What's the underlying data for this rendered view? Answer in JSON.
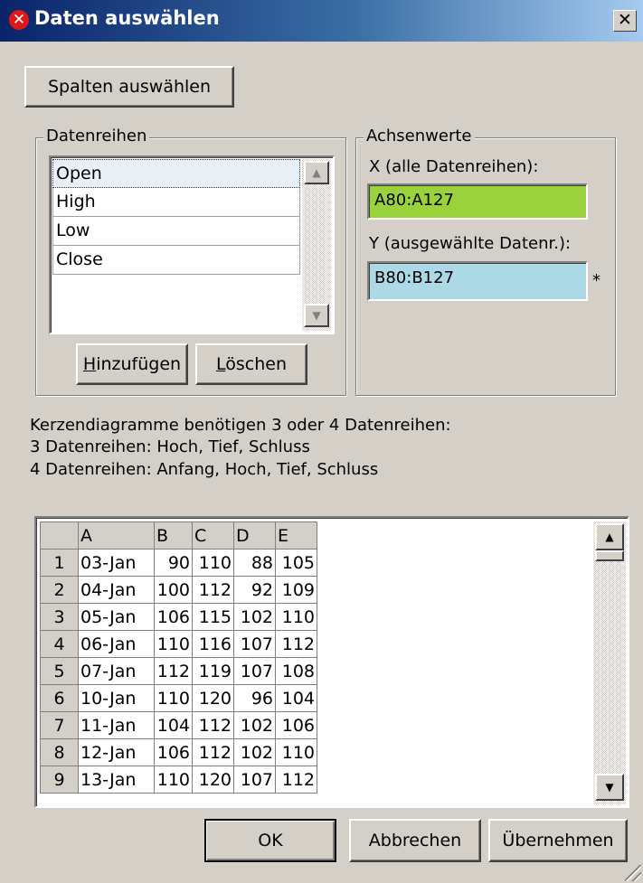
{
  "window": {
    "title": "Daten auswählen",
    "close_glyph": "✕"
  },
  "toolbar": {
    "select_columns_label": "Spalten auswählen"
  },
  "series_group": {
    "legend": "Datenreihen",
    "items": [
      "Open",
      "High",
      "Low",
      "Close"
    ],
    "selected_index": 0,
    "add_label_prefix": "H",
    "add_label_rest": "inzufügen",
    "delete_label_prefix": "L",
    "delete_label_rest": "öschen"
  },
  "axis_group": {
    "legend": "Achsenwerte",
    "x_label": "X (alle Datenreihen):",
    "x_value": "A80:A127",
    "x_color": "#9ad23c",
    "y_label": "Y (ausgewählte Datenr.):",
    "y_value": "B80:B127",
    "y_color": "#add8e6",
    "y_marker": "*"
  },
  "info": {
    "line1": "Kerzendiagramme benötigen 3 oder 4 Datenreihen:",
    "line2": "3 Datenreihen: Hoch, Tief, Schluss",
    "line3": "4 Datenreihen: Anfang, Hoch, Tief, Schluss"
  },
  "grid": {
    "columns": [
      "A",
      "B",
      "C",
      "D",
      "E"
    ],
    "rows": [
      [
        "1",
        "03-Jan",
        "90",
        "110",
        "88",
        "105"
      ],
      [
        "2",
        "04-Jan",
        "100",
        "112",
        "92",
        "109"
      ],
      [
        "3",
        "05-Jan",
        "106",
        "115",
        "102",
        "110"
      ],
      [
        "4",
        "06-Jan",
        "110",
        "116",
        "107",
        "112"
      ],
      [
        "5",
        "07-Jan",
        "112",
        "119",
        "107",
        "108"
      ],
      [
        "6",
        "10-Jan",
        "110",
        "120",
        "96",
        "104"
      ],
      [
        "7",
        "11-Jan",
        "104",
        "112",
        "102",
        "106"
      ],
      [
        "8",
        "12-Jan",
        "106",
        "112",
        "102",
        "110"
      ],
      [
        "9",
        "13-Jan",
        "110",
        "120",
        "107",
        "112"
      ]
    ]
  },
  "footer": {
    "ok_label": "OK",
    "cancel_label": "Abbrechen",
    "apply_label": "Übernehmen"
  },
  "icons": {
    "scroll_up": "▲",
    "scroll_down": "▼"
  }
}
